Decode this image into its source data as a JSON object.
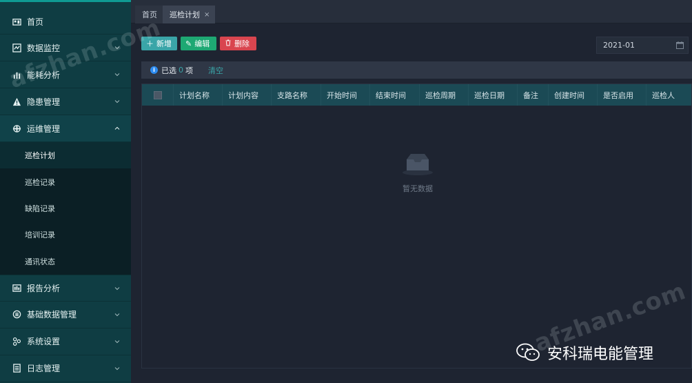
{
  "sidebar": {
    "items": [
      {
        "label": "首页",
        "icon": "home-icon",
        "chevron": false
      },
      {
        "label": "数据监控",
        "icon": "monitor-icon",
        "chevron": true
      },
      {
        "label": "能耗分析",
        "icon": "bar-chart-icon",
        "chevron": true
      },
      {
        "label": "隐患管理",
        "icon": "warning-icon",
        "chevron": true
      },
      {
        "label": "运维管理",
        "icon": "maintenance-icon",
        "chevron": true,
        "open": true
      }
    ],
    "submenu": [
      {
        "label": "巡检计划",
        "active": true
      },
      {
        "label": "巡检记录"
      },
      {
        "label": "缺陷记录"
      },
      {
        "label": "培训记录"
      },
      {
        "label": "通讯状态"
      }
    ],
    "items_after": [
      {
        "label": "报告分析",
        "icon": "report-icon"
      },
      {
        "label": "基础数据管理",
        "icon": "database-icon"
      },
      {
        "label": "系统设置",
        "icon": "settings-icon"
      },
      {
        "label": "日志管理",
        "icon": "log-icon"
      }
    ]
  },
  "tabs": {
    "home": "首页",
    "active": "巡检计划",
    "close": "×"
  },
  "toolbar": {
    "add": "新增",
    "edit": "编辑",
    "delete": "删除"
  },
  "date_filter": {
    "value": "2021-01"
  },
  "selection": {
    "prefix": "已选",
    "count": "0",
    "suffix": "项",
    "clear": "清空"
  },
  "table": {
    "columns": [
      "计划名称",
      "计划内容",
      "支路名称",
      "开始时间",
      "结束时间",
      "巡检周期",
      "巡检日期",
      "备注",
      "创建时间",
      "是否启用",
      "巡检人"
    ],
    "empty_text": "暂无数据"
  },
  "watermark": {
    "text": "afzhan.com",
    "brand": "安科瑞电能管理"
  },
  "colors": {
    "sidebar_bg": "#0f3d43",
    "accent": "#3aa5a8",
    "edit": "#1ea873",
    "delete": "#d9454f",
    "header_bg": "#1b4a55"
  }
}
